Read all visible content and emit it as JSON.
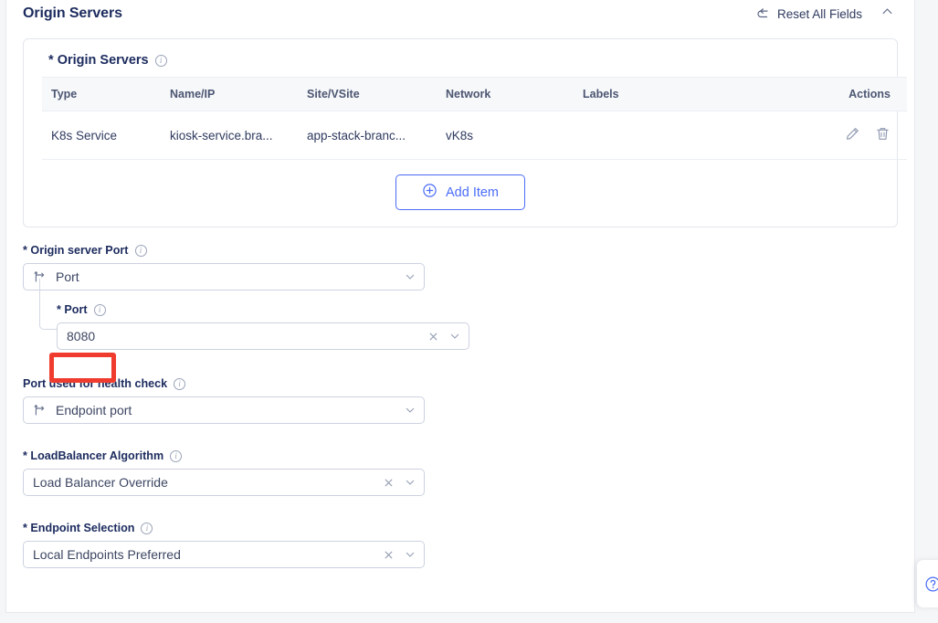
{
  "section": {
    "title": "Origin Servers",
    "reset_label": "Reset All Fields",
    "reset_icon": "undo-arrow-icon",
    "collapse_icon": "chevron-up-icon"
  },
  "origin_servers_card": {
    "label": "Origin Servers",
    "required_marker": "*",
    "info_icon": "info-icon",
    "table": {
      "columns": [
        "Type",
        "Name/IP",
        "Site/VSite",
        "Network",
        "Labels",
        "Actions"
      ],
      "rows": [
        {
          "type": "K8s Service",
          "name_ip": "kiosk-service.bra...",
          "site_vsite": "app-stack-branc...",
          "network": "vK8s",
          "labels": "",
          "actions": [
            "edit-pencil-icon",
            "delete-trash-icon"
          ]
        }
      ]
    },
    "add_item_label": "Add Item",
    "add_item_icon": "plus-circle-icon"
  },
  "fields": {
    "origin_server_port": {
      "label": "Origin server Port",
      "required_marker": "*",
      "value": "Port",
      "icon": "branch-fork-icon",
      "chevron": "chevron-down-icon"
    },
    "port": {
      "label": "Port",
      "required_marker": "*",
      "value": "8080",
      "clear_icon": "clear-x-icon",
      "chevron": "chevron-down-icon",
      "highlighted": true
    },
    "health_check_port": {
      "label": "Port used for health check",
      "required_marker": "",
      "value": "Endpoint port",
      "icon": "branch-fork-icon",
      "chevron": "chevron-down-icon"
    },
    "loadbalancer_algorithm": {
      "label": "LoadBalancer Algorithm",
      "required_marker": "*",
      "value": "Load Balancer Override",
      "clear_icon": "clear-x-icon",
      "chevron": "chevron-down-icon"
    },
    "endpoint_selection": {
      "label": "Endpoint Selection",
      "required_marker": "*",
      "value": "Local Endpoints Preferred",
      "clear_icon": "clear-x-icon",
      "chevron": "chevron-down-icon"
    }
  },
  "help_widget": {
    "icon": "question-circle-icon"
  },
  "colors": {
    "accent": "#4a6cf7",
    "title": "#1c2b5e",
    "highlight": "#f03c2e",
    "border": "#ccd2e0"
  }
}
